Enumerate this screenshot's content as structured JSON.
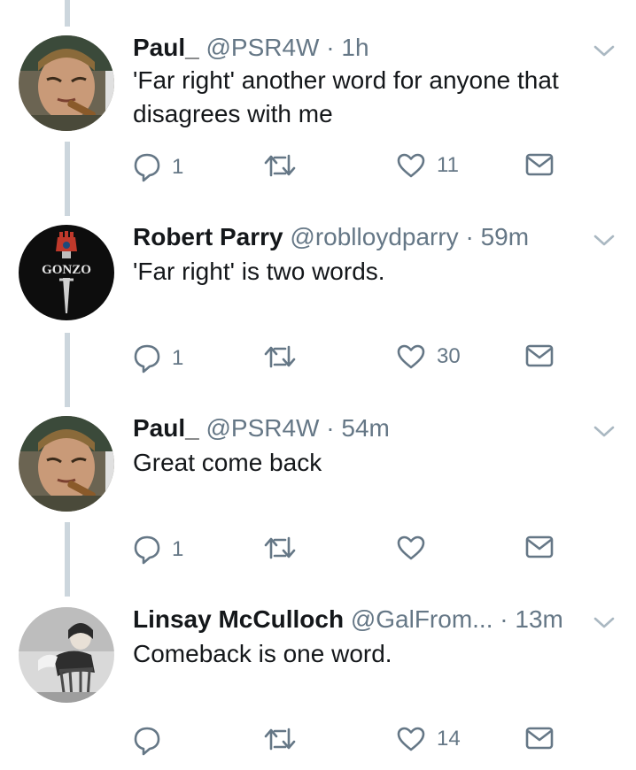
{
  "tweets": [
    {
      "name": "Paul_",
      "handle": "@PSR4W",
      "separator": "·",
      "time": "1h",
      "text_lines": [
        "'Far right' another word for anyone that",
        "disagrees with me"
      ],
      "reply_count": "1",
      "retweet_count": "",
      "like_count": "11",
      "avatar": "man-with-cigar-avatar"
    },
    {
      "name": "Robert Parry",
      "handle": "@roblloydparry",
      "separator": "·",
      "time": "59m",
      "text_lines": [
        "'Far right' is two words."
      ],
      "reply_count": "1",
      "retweet_count": "",
      "like_count": "30",
      "avatar": "gonzo-fist-logo-avatar",
      "avatar_logo_text": "GONZO"
    },
    {
      "name": "Paul_",
      "handle": "@PSR4W",
      "separator": "·",
      "time": "54m",
      "text_lines": [
        "Great come back"
      ],
      "reply_count": "1",
      "retweet_count": "",
      "like_count": "",
      "avatar": "man-with-cigar-avatar"
    },
    {
      "name": "Linsay McCulloch",
      "handle": "@GalFrom...",
      "separator": "·",
      "time": "13m",
      "text_lines": [
        "Comeback is one word."
      ],
      "reply_count": "",
      "retweet_count": "",
      "like_count": "14",
      "avatar": "vintage-photo-woman-avatar"
    }
  ],
  "icons": {
    "reply": "reply-icon",
    "retweet": "retweet-icon",
    "like": "heart-icon",
    "message": "envelope-icon",
    "menu": "chevron-down-icon"
  },
  "colors": {
    "text": "#14171a",
    "secondary": "#657786",
    "thread_line": "#ccd6dd"
  }
}
